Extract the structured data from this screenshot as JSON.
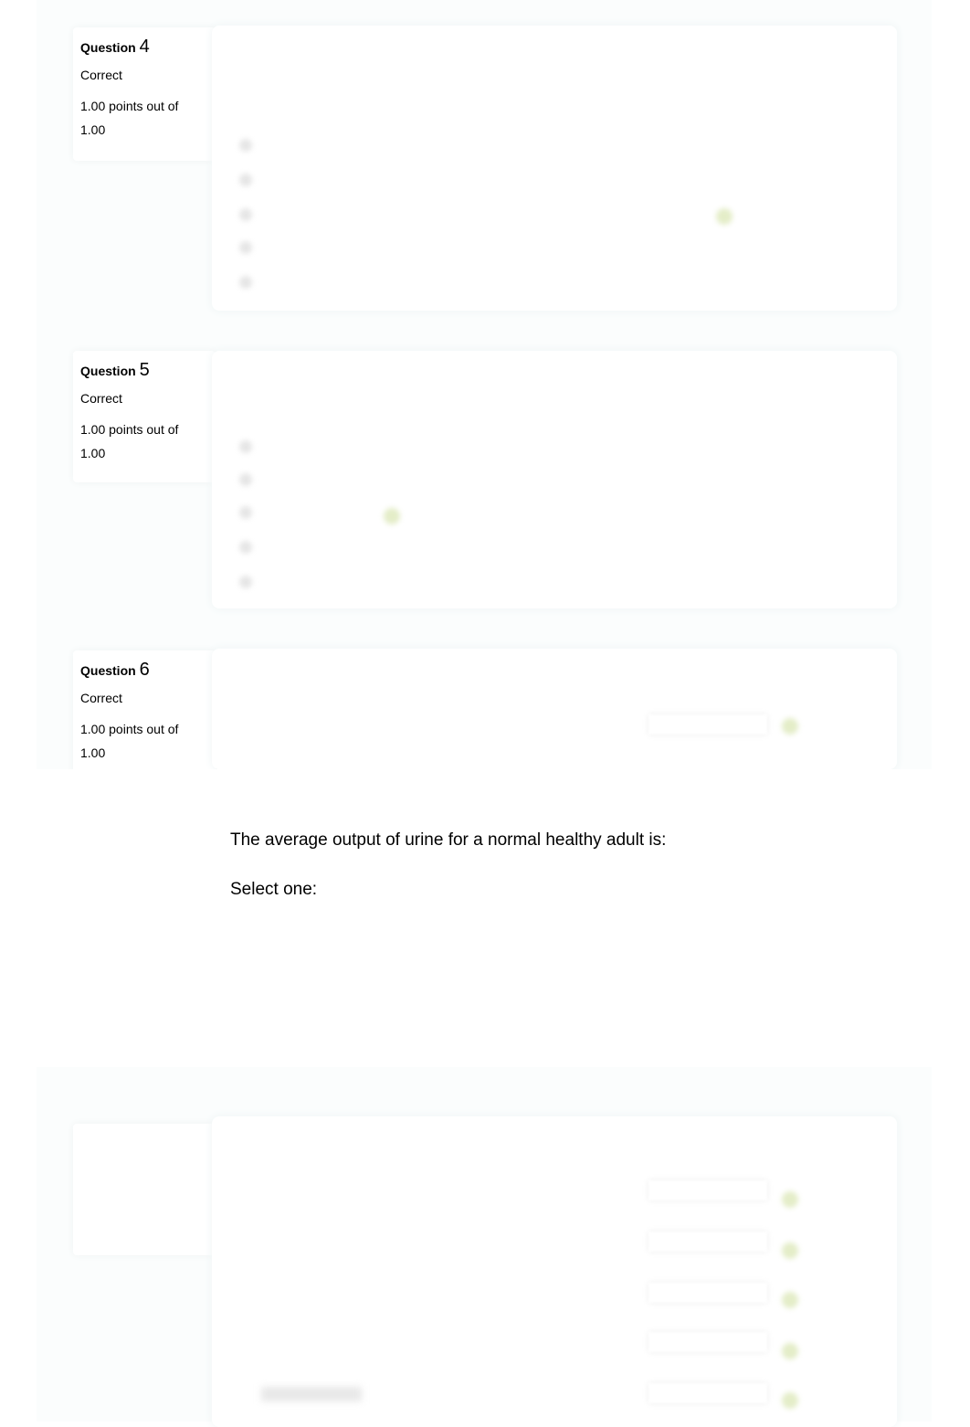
{
  "questions": [
    {
      "label": "Question",
      "number": "4",
      "status": "Correct",
      "points": "1.00 points out of",
      "max": "1.00"
    },
    {
      "label": "Question",
      "number": "5",
      "status": "Correct",
      "points": "1.00 points out of",
      "max": "1.00"
    },
    {
      "label": "Question",
      "number": "6",
      "status": "Correct",
      "points": "1.00 points out of",
      "max": "1.00"
    }
  ],
  "revealed": {
    "question": "The average output of urine for a normal healthy adult is:",
    "prompt": "Select one:"
  },
  "colors": {
    "check": "#d6e4a8",
    "shadow": "#eef4f5"
  }
}
